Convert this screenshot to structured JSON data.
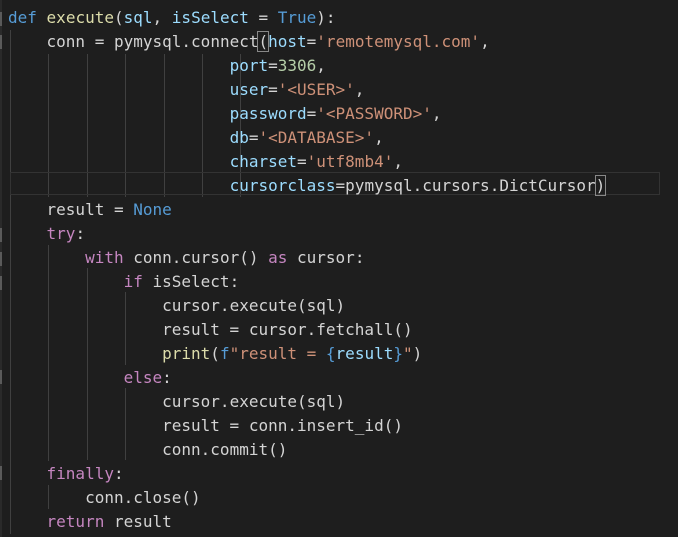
{
  "editor": {
    "lines": [
      [
        {
          "t": "def",
          "c": "kwb"
        },
        {
          "t": " ",
          "c": "pln"
        },
        {
          "t": "execute",
          "c": "fn"
        },
        {
          "t": "(",
          "c": "pun"
        },
        {
          "t": "sql",
          "c": "var"
        },
        {
          "t": ", ",
          "c": "pun"
        },
        {
          "t": "isSelect",
          "c": "var"
        },
        {
          "t": " = ",
          "c": "op"
        },
        {
          "t": "True",
          "c": "kwb"
        },
        {
          "t": "):",
          "c": "pun"
        }
      ],
      [
        {
          "t": "    ",
          "c": "pln"
        },
        {
          "t": "conn",
          "c": "pln"
        },
        {
          "t": " = ",
          "c": "op"
        },
        {
          "t": "pymysql",
          "c": "pln"
        },
        {
          "t": ".",
          "c": "pun"
        },
        {
          "t": "connect",
          "c": "pln"
        },
        {
          "t": "(",
          "c": "pun",
          "m": true
        },
        {
          "t": "host",
          "c": "var"
        },
        {
          "t": "=",
          "c": "op"
        },
        {
          "t": "'remotemysql.com'",
          "c": "str"
        },
        {
          "t": ",",
          "c": "pun"
        }
      ],
      [
        {
          "t": "                       ",
          "c": "pln"
        },
        {
          "t": "port",
          "c": "var"
        },
        {
          "t": "=",
          "c": "op"
        },
        {
          "t": "3306",
          "c": "num"
        },
        {
          "t": ",",
          "c": "pun"
        }
      ],
      [
        {
          "t": "                       ",
          "c": "pln"
        },
        {
          "t": "user",
          "c": "var"
        },
        {
          "t": "=",
          "c": "op"
        },
        {
          "t": "'<USER>'",
          "c": "str"
        },
        {
          "t": ",",
          "c": "pun"
        }
      ],
      [
        {
          "t": "                       ",
          "c": "pln"
        },
        {
          "t": "password",
          "c": "var"
        },
        {
          "t": "=",
          "c": "op"
        },
        {
          "t": "'<PASSWORD>'",
          "c": "str"
        },
        {
          "t": ",",
          "c": "pun"
        }
      ],
      [
        {
          "t": "                       ",
          "c": "pln"
        },
        {
          "t": "db",
          "c": "var"
        },
        {
          "t": "=",
          "c": "op"
        },
        {
          "t": "'<DATABASE>'",
          "c": "str"
        },
        {
          "t": ",",
          "c": "pun"
        }
      ],
      [
        {
          "t": "                       ",
          "c": "pln"
        },
        {
          "t": "charset",
          "c": "var"
        },
        {
          "t": "=",
          "c": "op"
        },
        {
          "t": "'utf8mb4'",
          "c": "str"
        },
        {
          "t": ",",
          "c": "pun"
        }
      ],
      [
        {
          "t": "                       ",
          "c": "pln"
        },
        {
          "t": "cursorclass",
          "c": "var"
        },
        {
          "t": "=",
          "c": "op"
        },
        {
          "t": "pymysql",
          "c": "pln"
        },
        {
          "t": ".",
          "c": "pun"
        },
        {
          "t": "cursors",
          "c": "pln"
        },
        {
          "t": ".",
          "c": "pun"
        },
        {
          "t": "DictCursor",
          "c": "pln"
        },
        {
          "t": ")",
          "c": "pun",
          "m": true
        }
      ],
      [
        {
          "t": "    ",
          "c": "pln"
        },
        {
          "t": "result",
          "c": "pln"
        },
        {
          "t": " = ",
          "c": "op"
        },
        {
          "t": "None",
          "c": "kwb"
        }
      ],
      [
        {
          "t": "    ",
          "c": "pln"
        },
        {
          "t": "try",
          "c": "kw"
        },
        {
          "t": ":",
          "c": "pun"
        }
      ],
      [
        {
          "t": "        ",
          "c": "pln"
        },
        {
          "t": "with",
          "c": "kw"
        },
        {
          "t": " ",
          "c": "pln"
        },
        {
          "t": "conn",
          "c": "pln"
        },
        {
          "t": ".",
          "c": "pun"
        },
        {
          "t": "cursor",
          "c": "pln"
        },
        {
          "t": "()",
          "c": "pun"
        },
        {
          "t": " ",
          "c": "pln"
        },
        {
          "t": "as",
          "c": "kw"
        },
        {
          "t": " ",
          "c": "pln"
        },
        {
          "t": "cursor",
          "c": "pln"
        },
        {
          "t": ":",
          "c": "pun"
        }
      ],
      [
        {
          "t": "            ",
          "c": "pln"
        },
        {
          "t": "if",
          "c": "kw"
        },
        {
          "t": " ",
          "c": "pln"
        },
        {
          "t": "isSelect",
          "c": "pln"
        },
        {
          "t": ":",
          "c": "pun"
        }
      ],
      [
        {
          "t": "                ",
          "c": "pln"
        },
        {
          "t": "cursor",
          "c": "pln"
        },
        {
          "t": ".",
          "c": "pun"
        },
        {
          "t": "execute",
          "c": "pln"
        },
        {
          "t": "(",
          "c": "pun"
        },
        {
          "t": "sql",
          "c": "pln"
        },
        {
          "t": ")",
          "c": "pun"
        }
      ],
      [
        {
          "t": "                ",
          "c": "pln"
        },
        {
          "t": "result",
          "c": "pln"
        },
        {
          "t": " = ",
          "c": "op"
        },
        {
          "t": "cursor",
          "c": "pln"
        },
        {
          "t": ".",
          "c": "pun"
        },
        {
          "t": "fetchall",
          "c": "pln"
        },
        {
          "t": "()",
          "c": "pun"
        }
      ],
      [
        {
          "t": "                ",
          "c": "pln"
        },
        {
          "t": "print",
          "c": "fn"
        },
        {
          "t": "(",
          "c": "pun"
        },
        {
          "t": "f",
          "c": "kwb"
        },
        {
          "t": "\"result = ",
          "c": "str"
        },
        {
          "t": "{",
          "c": "kwb"
        },
        {
          "t": "result",
          "c": "var"
        },
        {
          "t": "}",
          "c": "kwb"
        },
        {
          "t": "\"",
          "c": "str"
        },
        {
          "t": ")",
          "c": "pun"
        }
      ],
      [
        {
          "t": "            ",
          "c": "pln"
        },
        {
          "t": "else",
          "c": "kw"
        },
        {
          "t": ":",
          "c": "pun"
        }
      ],
      [
        {
          "t": "                ",
          "c": "pln"
        },
        {
          "t": "cursor",
          "c": "pln"
        },
        {
          "t": ".",
          "c": "pun"
        },
        {
          "t": "execute",
          "c": "pln"
        },
        {
          "t": "(",
          "c": "pun"
        },
        {
          "t": "sql",
          "c": "pln"
        },
        {
          "t": ")",
          "c": "pun"
        }
      ],
      [
        {
          "t": "                ",
          "c": "pln"
        },
        {
          "t": "result",
          "c": "pln"
        },
        {
          "t": " = ",
          "c": "op"
        },
        {
          "t": "conn",
          "c": "pln"
        },
        {
          "t": ".",
          "c": "pun"
        },
        {
          "t": "insert_id",
          "c": "pln"
        },
        {
          "t": "()",
          "c": "pun"
        }
      ],
      [
        {
          "t": "                ",
          "c": "pln"
        },
        {
          "t": "conn",
          "c": "pln"
        },
        {
          "t": ".",
          "c": "pun"
        },
        {
          "t": "commit",
          "c": "pln"
        },
        {
          "t": "()",
          "c": "pun"
        }
      ],
      [
        {
          "t": "    ",
          "c": "pln"
        },
        {
          "t": "finally",
          "c": "kw"
        },
        {
          "t": ":",
          "c": "pun"
        }
      ],
      [
        {
          "t": "        ",
          "c": "pln"
        },
        {
          "t": "conn",
          "c": "pln"
        },
        {
          "t": ".",
          "c": "pun"
        },
        {
          "t": "close",
          "c": "pln"
        },
        {
          "t": "()",
          "c": "pun"
        }
      ],
      [
        {
          "t": "    ",
          "c": "pln"
        },
        {
          "t": "return",
          "c": "kw"
        },
        {
          "t": " ",
          "c": "pln"
        },
        {
          "t": "result",
          "c": "pln"
        }
      ]
    ]
  }
}
